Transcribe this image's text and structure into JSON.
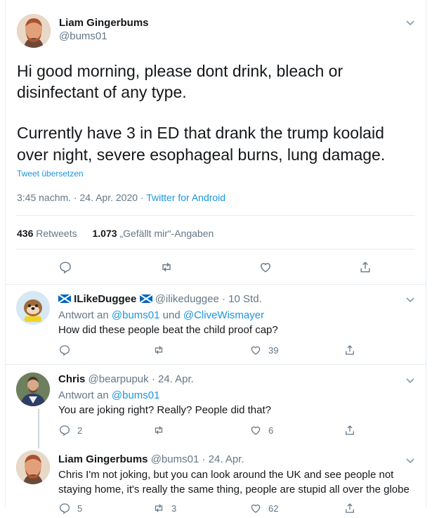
{
  "main_tweet": {
    "author_name": "Liam Gingerbums",
    "handle": "@bums01",
    "text_line1": "Hi good morning, please dont drink, bleach or",
    "text_line2": "disinfectant of any type.",
    "text_line3": "Currently have 3 in ED that drank the trump koolaid",
    "text_line4": "over night, severe esophageal burns, lung damage.",
    "translate_label": "Tweet übersetzen",
    "time": "3:45 nachm.",
    "date": "24. Apr. 2020",
    "source": "Twitter for Android",
    "retweets_count": "436",
    "retweets_label": "Retweets",
    "likes_count": "1.073",
    "likes_label": "„Gefällt mir“-Angaben"
  },
  "replies": [
    {
      "author_name": "ILikeDuggee",
      "handle": "@ilikeduggee",
      "time": "10 Std.",
      "reply_prefix": "Antwort an",
      "reply_to_1": "@bums01",
      "reply_joiner": "und",
      "reply_to_2": "@CliveWismayer",
      "text": "How did these people beat the child proof cap?",
      "replies_count": "",
      "retweets_count": "",
      "likes_count": "39"
    },
    {
      "author_name": "Chris",
      "handle": "@bearpupuk",
      "time": "24. Apr.",
      "reply_prefix": "Antwort an",
      "reply_to_1": "@bums01",
      "text": "You are joking right? Really? People did that?",
      "replies_count": "2",
      "retweets_count": "",
      "likes_count": "6"
    },
    {
      "author_name": "Liam Gingerbums",
      "handle": "@bums01",
      "time": "24. Apr.",
      "text_line1": "Chris I'm not joking, but you can look around the UK and see people not",
      "text_line2": "staying home, it's really the same thing, people are stupid all over the globe",
      "replies_count": "5",
      "retweets_count": "3",
      "likes_count": "62"
    }
  ],
  "separator_dot": "·",
  "colors": {
    "accent": "#1b95e0",
    "muted": "#657786",
    "border": "#e6ecf0"
  }
}
